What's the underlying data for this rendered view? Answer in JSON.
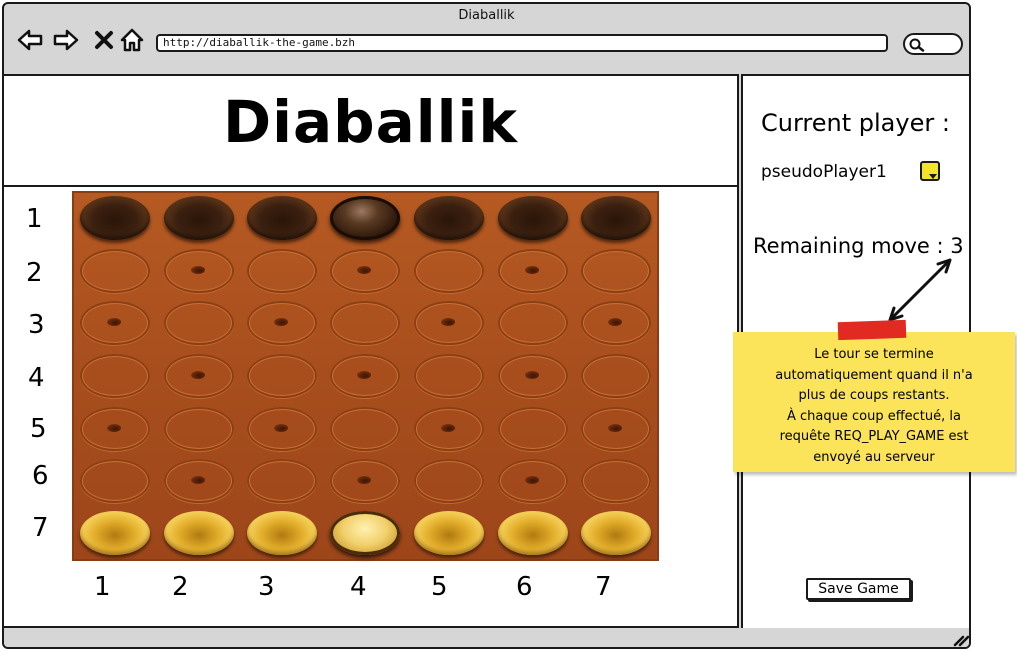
{
  "browser": {
    "title": "Diaballik",
    "url": "http://diaballik-the-game.bzh"
  },
  "page": {
    "heading": "Diaballik"
  },
  "board": {
    "row_labels": [
      "1",
      "2",
      "3",
      "4",
      "5",
      "6",
      "7"
    ],
    "col_labels": [
      "1",
      "2",
      "3",
      "4",
      "5",
      "6",
      "7"
    ],
    "rows": [
      [
        "dark",
        "dark",
        "dark",
        "dark-ball",
        "dark",
        "dark",
        "dark"
      ],
      [
        "hole",
        "hole-dot",
        "hole",
        "hole-dot",
        "hole",
        "hole-dot",
        "hole"
      ],
      [
        "hole-dot",
        "hole",
        "hole-dot",
        "hole",
        "hole-dot",
        "hole",
        "hole-dot"
      ],
      [
        "hole",
        "hole-dot",
        "hole",
        "hole-dot",
        "hole",
        "hole-dot",
        "hole"
      ],
      [
        "hole-dot",
        "hole",
        "hole-dot",
        "hole",
        "hole-dot",
        "hole",
        "hole-dot"
      ],
      [
        "hole",
        "hole-dot",
        "hole",
        "hole-dot",
        "hole",
        "hole-dot",
        "hole"
      ],
      [
        "light",
        "light",
        "light",
        "light-ball",
        "light",
        "light",
        "light"
      ]
    ],
    "colors": {
      "board": "#a84e1d",
      "dark_piece": "#3b2010",
      "light_piece": "#e2ad2a"
    }
  },
  "sidebar": {
    "current_player_label": "Current player :",
    "player_name": "pseudoPlayer1",
    "player_color": "#f3e32a",
    "remaining_moves_label": "Remaining move : 3",
    "save_button": "Save Game"
  },
  "annotation": {
    "text": "Le tour se termine\nautomatiquement quand il n'a\nplus de coups restants.\nÀ chaque coup effectué, la\nrequête REQ_PLAY_GAME est\nenvoyé au serveur",
    "note_color": "#fbe45a",
    "tape_color": "#e02a22"
  }
}
